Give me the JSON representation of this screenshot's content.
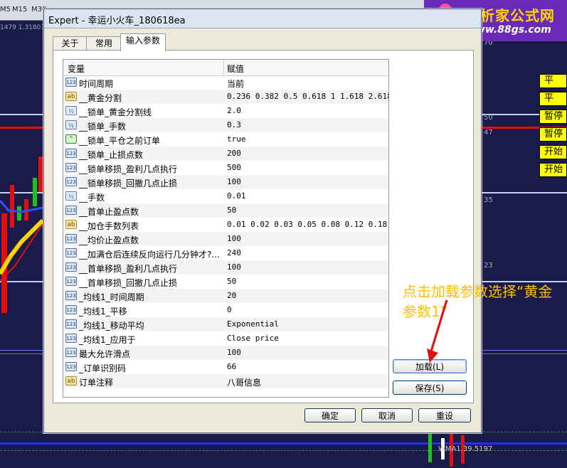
{
  "background": {
    "timeframes": [
      "M5",
      "M15",
      "M30"
    ],
    "price_label": "1479 1.31807",
    "scale_labels": [
      "70",
      "50",
      "47",
      "35",
      "23"
    ],
    "bottom_label": "WMA1.39.5197",
    "side_labels": [
      "平",
      "平",
      "暂停",
      "暂停",
      "开始",
      "开始"
    ]
  },
  "logo": {
    "title": "分析家公式网",
    "url": "www.88gs.com"
  },
  "dialog": {
    "title": "Expert - 幸运小火车_180618ea",
    "tabs": [
      {
        "label": "关于",
        "active": false
      },
      {
        "label": "常用",
        "active": false
      },
      {
        "label": "输入参数",
        "active": true
      }
    ],
    "grid": {
      "col_variable": "变量",
      "col_value": "赋值",
      "rows": [
        {
          "icon": "123",
          "name": "时间周期",
          "value": "当前"
        },
        {
          "icon": "ab",
          "name": "__黄金分割",
          "value": "0.236 0.382 0.5 0.618 1 1.618 2.618"
        },
        {
          "icon": "v2",
          "name": "__锁单_黄金分割线",
          "value": "2.0"
        },
        {
          "icon": "v2",
          "name": "__锁单_手数",
          "value": "0.3"
        },
        {
          "icon": "bool",
          "name": "__锁单_平仓之前订单",
          "value": "true"
        },
        {
          "icon": "123",
          "name": "__锁单_止损点数",
          "value": "200"
        },
        {
          "icon": "123",
          "name": "__锁单移损_盈利几点执行",
          "value": "500"
        },
        {
          "icon": "123",
          "name": "__锁单移损_回撤几点止损",
          "value": "100"
        },
        {
          "icon": "v2",
          "name": "__手数",
          "value": "0.01"
        },
        {
          "icon": "123",
          "name": "__首单止盈点数",
          "value": "50"
        },
        {
          "icon": "ab",
          "name": "__加仓手数列表",
          "value": "0.01 0.02 0.03 0.05 0.08 0.12 0.18"
        },
        {
          "icon": "123",
          "name": "__均价止盈点数",
          "value": "100"
        },
        {
          "icon": "123",
          "name": "__加满仓后连续反向运行几分钟才?...",
          "value": "240"
        },
        {
          "icon": "123",
          "name": "__首单移损_盈利几点执行",
          "value": "100"
        },
        {
          "icon": "123",
          "name": "__首单移损_回撤几点止损",
          "value": "50"
        },
        {
          "icon": "123",
          "name": "_均线1_时间周期",
          "value": "20"
        },
        {
          "icon": "123",
          "name": "_均线1_平移",
          "value": "0"
        },
        {
          "icon": "123",
          "name": "_均线1_移动平均",
          "value": "Exponential"
        },
        {
          "icon": "123",
          "name": "_均线1_应用于",
          "value": "Close price"
        },
        {
          "icon": "123",
          "name": "最大允许滑点",
          "value": "100"
        },
        {
          "icon": "123",
          "name": "_订单识别码",
          "value": "66"
        },
        {
          "icon": "ab",
          "name": "订单注释",
          "value": "八哥信息"
        }
      ]
    },
    "buttons": {
      "load": "加载(L)",
      "save": "保存(S)",
      "ok": "确定",
      "cancel": "取消",
      "reset": "重设"
    }
  },
  "annotation": "点击加载参数选择“黄金参数1”",
  "colors": {
    "chart_bg": "#1b1b4a",
    "dialog_bg": "#ece9d8",
    "accent_red": "#e01010",
    "annotation": "#ffc000"
  }
}
